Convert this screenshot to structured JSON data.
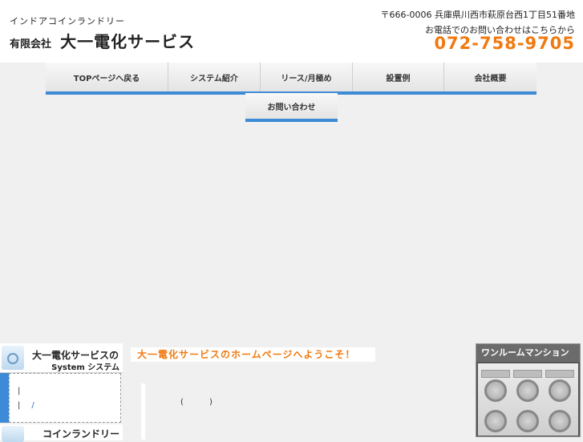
{
  "header": {
    "tagline": "インドアコインランドリー",
    "company_prefix": "有限会社",
    "company_name": "大一電化サービス",
    "address": "〒666-0006  兵庫県川西市萩原台西1丁目51番地",
    "contact_note": "お電話でのお問い合わせはこちらから",
    "phone": "072-758-9705"
  },
  "nav": {
    "items": [
      {
        "label": "TOPページへ戻る"
      },
      {
        "label": "システム紹介"
      },
      {
        "label": "リース/月極め"
      },
      {
        "label": "設置例"
      },
      {
        "label": "会社概要"
      }
    ],
    "contact_label": "お問い合わせ"
  },
  "sidebar": {
    "title": "大一電化サービスの",
    "subtitle": "System  システム",
    "line1": "|",
    "line2_bar": "|",
    "line2_link": "/",
    "coin_title": "コインランドリー"
  },
  "main": {
    "welcome": "大一電化サービスのホームページへようこそ！",
    "paren_open": "(",
    "paren_close": ")"
  },
  "right": {
    "title": "ワンルームマンション"
  },
  "colors": {
    "accent": "#3d8ad6",
    "phone": "#f07a10"
  }
}
